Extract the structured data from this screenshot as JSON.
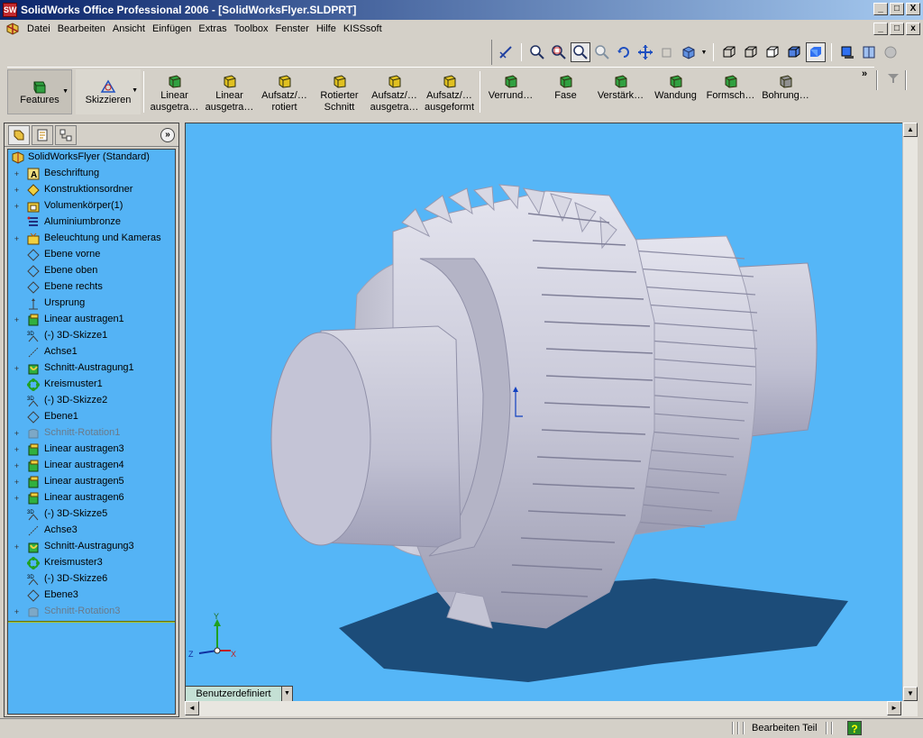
{
  "window": {
    "title": "SolidWorks Office Professional 2006 - [SolidWorksFlyer.SLDPRT]",
    "app_icon_text": "SW",
    "controls": {
      "minimize": "_",
      "restore": "□",
      "close": "X"
    }
  },
  "menubar": {
    "items": [
      "Datei",
      "Bearbeiten",
      "Ansicht",
      "Einfügen",
      "Extras",
      "Toolbox",
      "Fenster",
      "Hilfe",
      "KISSsoft"
    ],
    "mdi_controls": {
      "minimize": "_",
      "restore": "□",
      "close": "x"
    }
  },
  "command_manager": {
    "tabs": [
      {
        "label": "Features",
        "active": true
      },
      {
        "label": "Skizzieren",
        "active": false
      }
    ],
    "buttons": [
      {
        "line1": "Linear",
        "line2": "ausgetra…",
        "icon": "extruded-boss-icon"
      },
      {
        "line1": "Linear",
        "line2": "ausgetra…",
        "icon": "extruded-cut-icon"
      },
      {
        "line1": "Aufsatz/…",
        "line2": "rotiert",
        "icon": "revolved-boss-icon"
      },
      {
        "line1": "Rotierter",
        "line2": "Schnitt",
        "icon": "revolved-cut-icon"
      },
      {
        "line1": "Aufsatz/…",
        "line2": "ausgetra…",
        "icon": "swept-boss-icon"
      },
      {
        "line1": "Aufsatz/…",
        "line2": "ausgeformt",
        "icon": "loft-icon"
      },
      {
        "line1": "Verrund…",
        "line2": "",
        "icon": "fillet-icon"
      },
      {
        "line1": "Fase",
        "line2": "",
        "icon": "chamfer-icon"
      },
      {
        "line1": "Verstärk…",
        "line2": "",
        "icon": "rib-icon"
      },
      {
        "line1": "Wandung",
        "line2": "",
        "icon": "shell-icon"
      },
      {
        "line1": "Formsch…",
        "line2": "",
        "icon": "draft-icon"
      },
      {
        "line1": "Bohrung…",
        "line2": "",
        "icon": "hole-wizard-icon"
      }
    ],
    "more_chevron": "»"
  },
  "feature_manager": {
    "expand_symbol": "»",
    "tree": [
      {
        "label": "SolidWorksFlyer  (Standard)",
        "icon": "part-icon",
        "expander": "",
        "root": true,
        "dim": false
      },
      {
        "label": "Beschriftung",
        "icon": "annotations-icon",
        "expander": "+",
        "dim": false
      },
      {
        "label": "Konstruktionsordner",
        "icon": "design-binder-icon",
        "expander": "+",
        "dim": false
      },
      {
        "label": "Volumenkörper(1)",
        "icon": "solid-bodies-icon",
        "expander": "+",
        "dim": false
      },
      {
        "label": "Aluminiumbronze",
        "icon": "material-icon",
        "expander": "",
        "dim": false
      },
      {
        "label": "Beleuchtung und Kameras",
        "icon": "lighting-icon",
        "expander": "+",
        "dim": false
      },
      {
        "label": "Ebene vorne",
        "icon": "plane-icon",
        "expander": "",
        "dim": false
      },
      {
        "label": "Ebene oben",
        "icon": "plane-icon",
        "expander": "",
        "dim": false
      },
      {
        "label": "Ebene rechts",
        "icon": "plane-icon",
        "expander": "",
        "dim": false
      },
      {
        "label": "Ursprung",
        "icon": "origin-icon",
        "expander": "",
        "dim": false
      },
      {
        "label": "Linear austragen1",
        "icon": "extrude-feature-icon",
        "expander": "+",
        "dim": false
      },
      {
        "label": "(-) 3D-Skizze1",
        "icon": "3d-sketch-icon",
        "expander": "",
        "dim": false
      },
      {
        "label": "Achse1",
        "icon": "axis-icon",
        "expander": "",
        "dim": false
      },
      {
        "label": "Schnitt-Austragung1",
        "icon": "sweep-cut-icon",
        "expander": "+",
        "dim": false
      },
      {
        "label": "Kreismuster1",
        "icon": "circular-pattern-icon",
        "expander": "",
        "dim": false
      },
      {
        "label": "(-) 3D-Skizze2",
        "icon": "3d-sketch-icon",
        "expander": "",
        "dim": false
      },
      {
        "label": "Ebene1",
        "icon": "plane-icon",
        "expander": "",
        "dim": false
      },
      {
        "label": "Schnitt-Rotation1",
        "icon": "revolve-cut-icon",
        "expander": "+",
        "dim": true
      },
      {
        "label": "Linear austragen3",
        "icon": "extrude-feature-icon",
        "expander": "+",
        "dim": false
      },
      {
        "label": "Linear austragen4",
        "icon": "extrude-feature-icon",
        "expander": "+",
        "dim": false
      },
      {
        "label": "Linear austragen5",
        "icon": "extrude-feature-icon",
        "expander": "+",
        "dim": false
      },
      {
        "label": "Linear austragen6",
        "icon": "extrude-feature-icon",
        "expander": "+",
        "dim": false
      },
      {
        "label": "(-) 3D-Skizze5",
        "icon": "3d-sketch-icon",
        "expander": "",
        "dim": false
      },
      {
        "label": "Achse3",
        "icon": "axis-icon",
        "expander": "",
        "dim": false
      },
      {
        "label": "Schnitt-Austragung3",
        "icon": "sweep-cut-icon",
        "expander": "+",
        "dim": false
      },
      {
        "label": "Kreismuster3",
        "icon": "circular-pattern-icon",
        "expander": "",
        "dim": false
      },
      {
        "label": "(-) 3D-Skizze6",
        "icon": "3d-sketch-icon",
        "expander": "",
        "dim": false
      },
      {
        "label": "Ebene3",
        "icon": "plane-icon",
        "expander": "",
        "dim": false
      },
      {
        "label": "Schnitt-Rotation3",
        "icon": "revolve-cut-icon",
        "expander": "+",
        "dim": true
      }
    ]
  },
  "viewport": {
    "view_orientation": "Benutzerdefiniert",
    "triad": {
      "x": "X",
      "y": "Y",
      "z": "Z"
    },
    "background_color": "#55b6f7"
  },
  "statusbar": {
    "mode": "Bearbeiten Teil",
    "help_symbol": "?"
  }
}
